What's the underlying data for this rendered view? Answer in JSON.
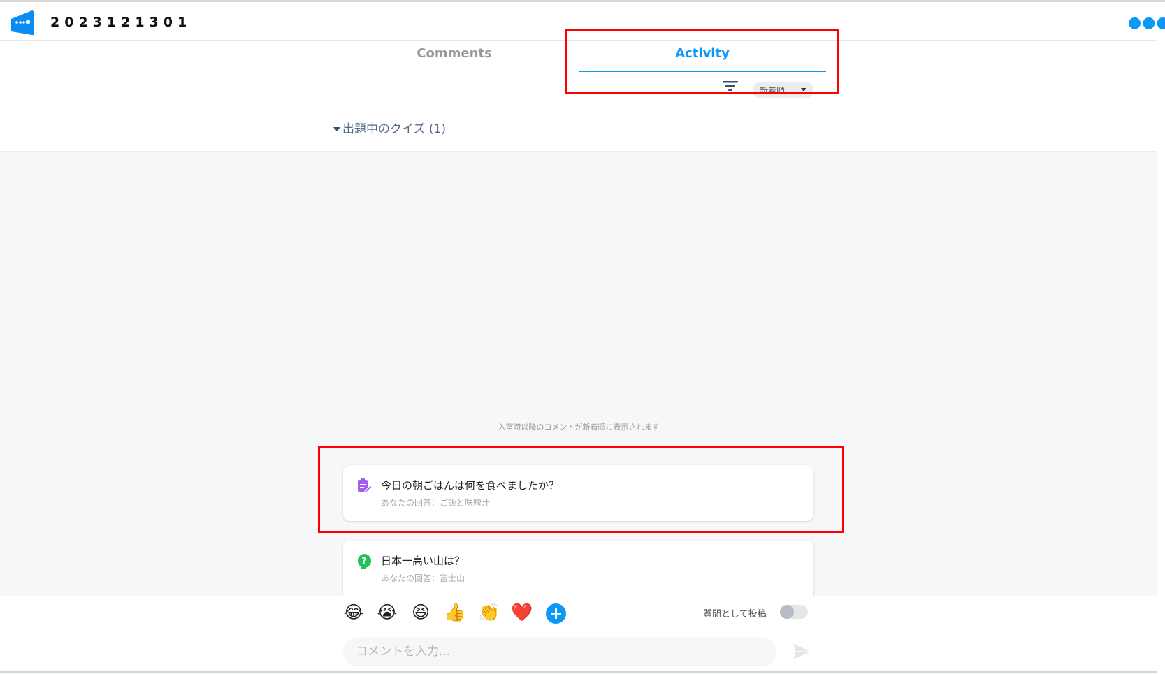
{
  "header": {
    "title": "2023121301",
    "logo_icon": "speech-bubble-logo-icon",
    "more_icon": "more-dots-icon"
  },
  "tabs": [
    {
      "label": "Comments",
      "active": false
    },
    {
      "label": "Activity",
      "active": true
    }
  ],
  "sort": {
    "filter_icon": "filter-icon",
    "selected": "新着順"
  },
  "section": {
    "label": "出題中のクイズ (1)"
  },
  "notice": "入室時以降のコメントが新着順に表示されます",
  "cards": [
    {
      "icon": "survey-clipboard-icon",
      "icon_color": "#a35bf0",
      "question": "今日の朝ごはんは何を食べましたか？",
      "answer": "あなたの回答：ご飯と味噌汁"
    },
    {
      "icon": "quiz-question-icon",
      "icon_color": "#22c25a",
      "question": "日本一高い山は？",
      "answer": "あなたの回答：富士山"
    }
  ],
  "reactions": [
    "😂",
    "😭",
    "😆",
    "👍",
    "👏",
    "❤️"
  ],
  "composer": {
    "post_as_question_label": "質問として投稿",
    "post_as_question_on": false,
    "placeholder": "コメントを入力..."
  },
  "colors": {
    "accent": "#0a9af5",
    "highlight": "#ff0000"
  }
}
